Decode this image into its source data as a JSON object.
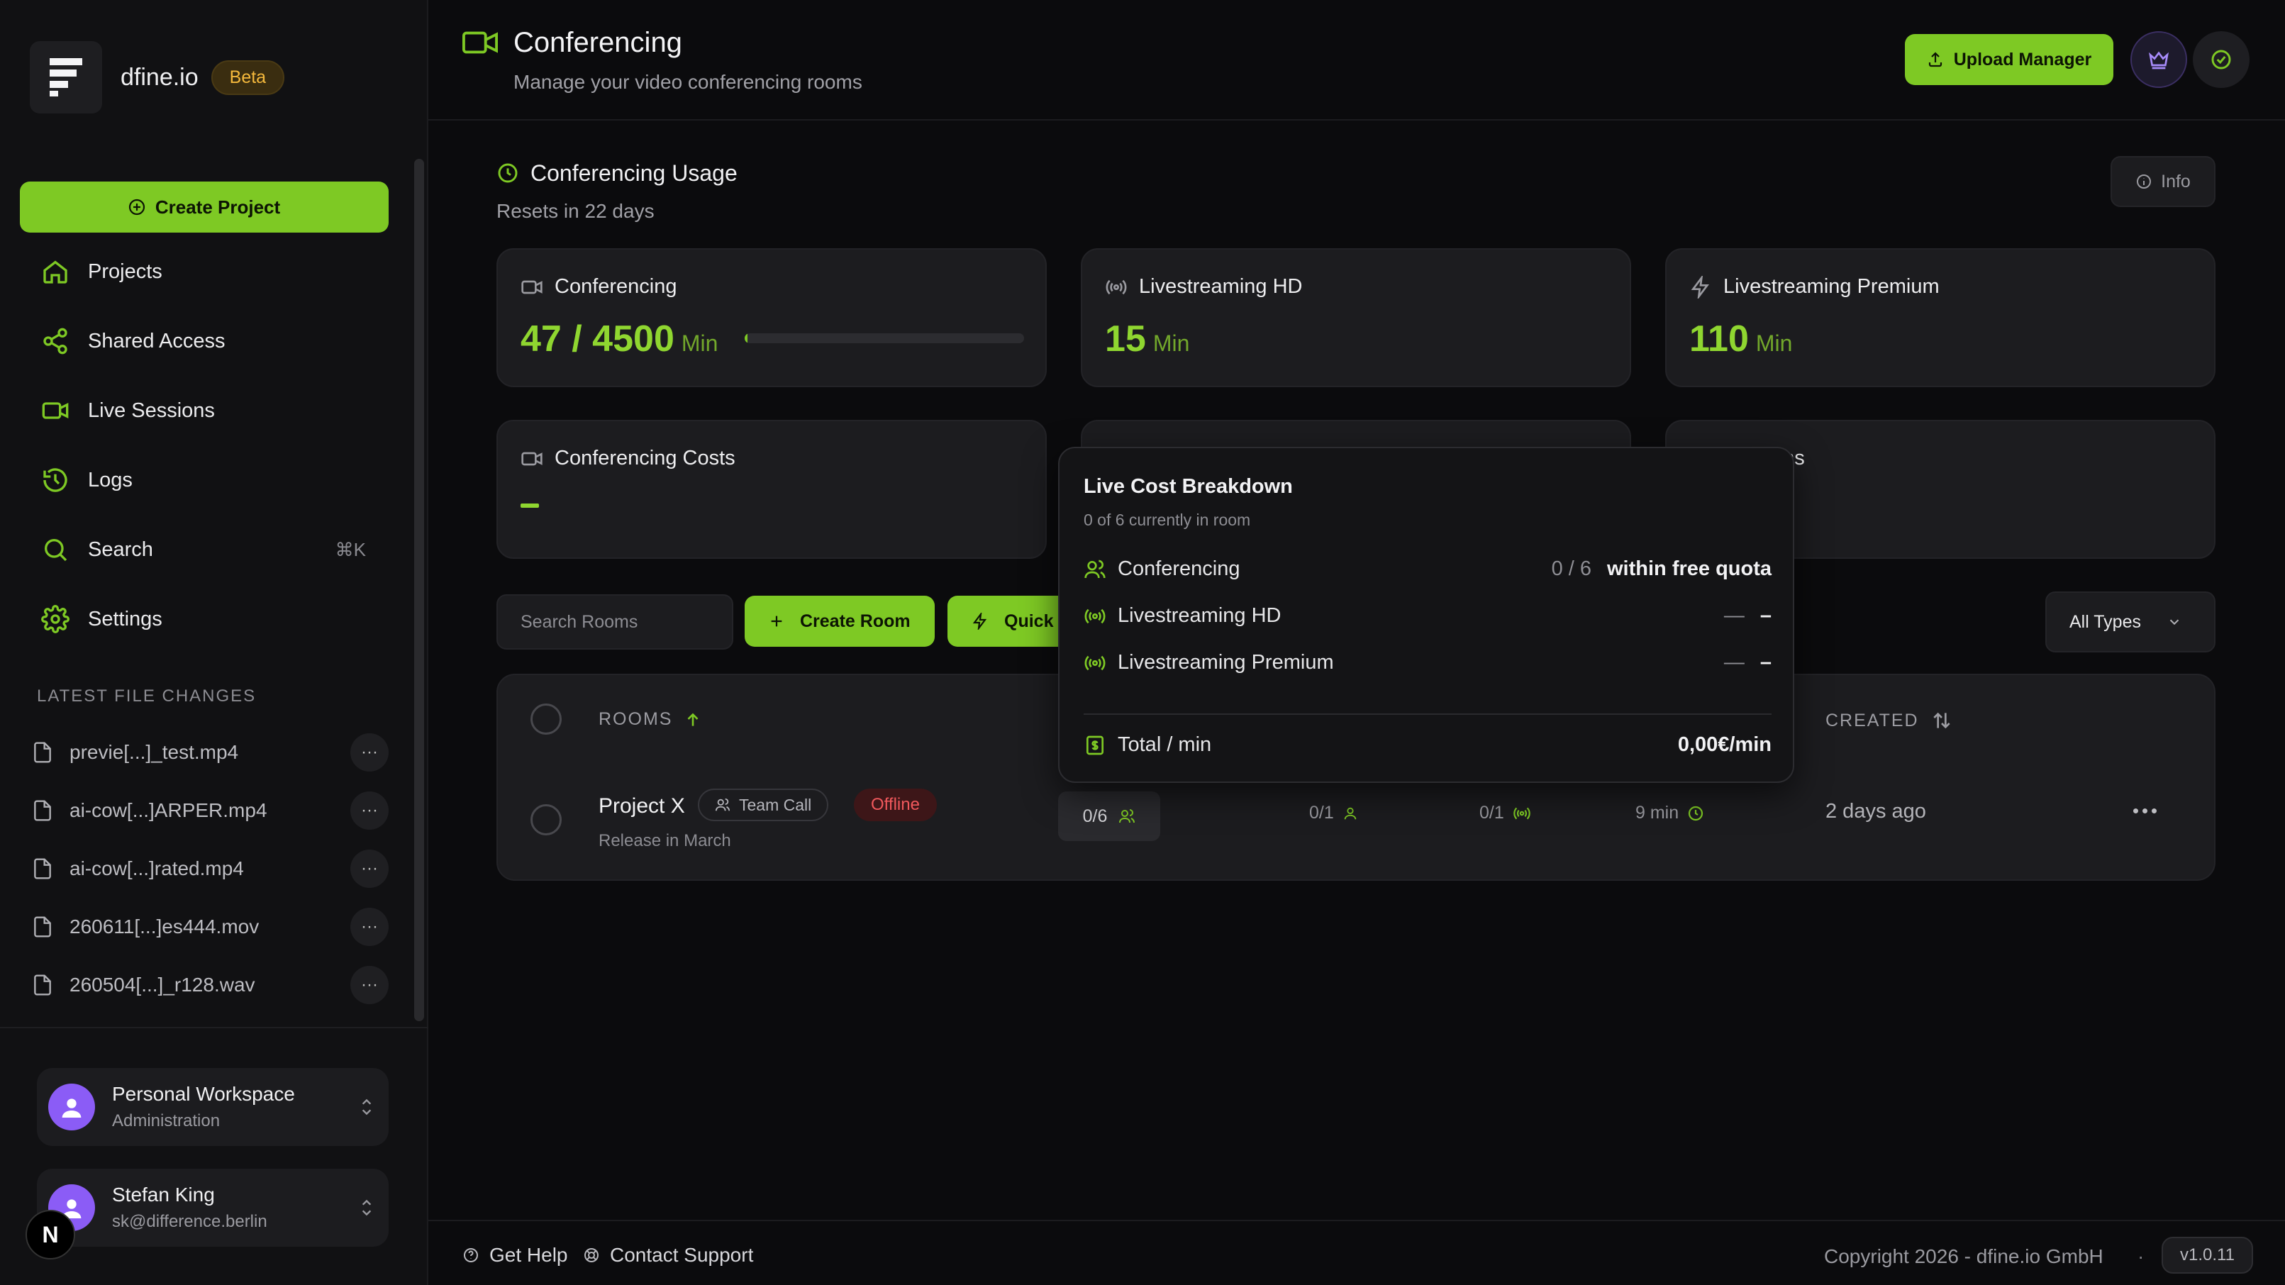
{
  "sidebar": {
    "brand_name": "dfine.io",
    "brand_badge": "Beta",
    "create_project_label": "Create Project",
    "nav": [
      {
        "label": "Projects",
        "icon": "home-icon"
      },
      {
        "label": "Shared Access",
        "icon": "share-icon"
      },
      {
        "label": "Live Sessions",
        "icon": "video-icon"
      },
      {
        "label": "Logs",
        "icon": "history-icon"
      },
      {
        "label": "Search",
        "icon": "search-icon",
        "shortcut": "⌘K"
      },
      {
        "label": "Settings",
        "icon": "gear-icon"
      }
    ],
    "latest_title": "LATEST FILE CHANGES",
    "files": [
      {
        "name": "previe[...]_test.mp4"
      },
      {
        "name": "ai-cow[...]ARPER.mp4"
      },
      {
        "name": "ai-cow[...]rated.mp4"
      },
      {
        "name": "260611[...]es444.mov"
      },
      {
        "name": "260504[...]_r128.wav"
      }
    ],
    "workspace": {
      "title": "Personal Workspace",
      "subtitle": "Administration"
    },
    "user": {
      "name": "Stefan King",
      "email": "sk@difference.berlin"
    },
    "next_badge": "N"
  },
  "header": {
    "title": "Conferencing",
    "subtitle": "Manage your video conferencing rooms",
    "upload_label": "Upload Manager"
  },
  "usage": {
    "title": "Conferencing Usage",
    "subtitle": "Resets in 22 days",
    "info_label": "Info",
    "cards": [
      {
        "title": "Conferencing",
        "value": "47 / 4500",
        "unit": "Min",
        "progress": 0.0104
      },
      {
        "title": "Livestreaming HD",
        "value": "15",
        "unit": "Min"
      },
      {
        "title": "Livestreaming Premium",
        "value": "110",
        "unit": "Min"
      },
      {
        "title": "Conferencing Costs",
        "value": "–"
      },
      {
        "title": "",
        "value": ""
      },
      {
        "title": "Rooms",
        "title_visible": "oms",
        "value": ""
      }
    ]
  },
  "toolbar": {
    "search_placeholder": "Search Rooms",
    "create_room_label": "Create Room",
    "quick_label": "Quick",
    "types_label": "All Types"
  },
  "table": {
    "headers": {
      "rooms": "ROOMS",
      "created": "CREATED"
    },
    "rows": [
      {
        "name": "Project X",
        "tag": "Team Call",
        "status": "Offline",
        "description": "Release in March",
        "capacity": "0/6",
        "conferencing": "0/1",
        "streaming": "0/1",
        "duration": "9 min",
        "created": "2 days ago"
      }
    ]
  },
  "popover": {
    "title": "Live Cost Breakdown",
    "subtitle": "0 of 6 currently in room",
    "rows": [
      {
        "label": "Conferencing",
        "count": "0 / 6",
        "value": "within free quota"
      },
      {
        "label": "Livestreaming HD",
        "count": "—",
        "value": "–"
      },
      {
        "label": "Livestreaming Premium",
        "count": "—",
        "value": "–"
      }
    ],
    "total_label": "Total / min",
    "total_value": "0,00€/min"
  },
  "footer": {
    "help_label": "Get Help",
    "support_label": "Contact Support",
    "copyright": "Copyright 2026 - dfine.io GmbH",
    "separator": "·",
    "version": "v1.0.11"
  },
  "colors": {
    "accent": "#7ec924",
    "background": "#0b0b0d",
    "panel": "#1c1c1f",
    "danger": "#f0585c",
    "purple": "#8b5cf6"
  }
}
